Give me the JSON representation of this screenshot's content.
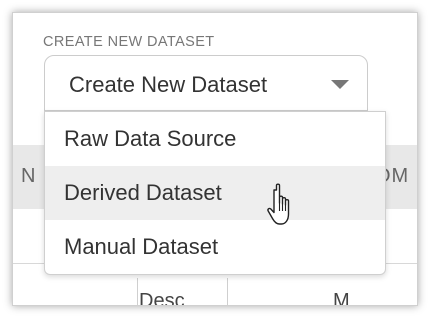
{
  "field": {
    "label": "CREATE NEW DATASET",
    "selected_value": "Create New Dataset"
  },
  "dropdown": {
    "items": [
      {
        "label": "Raw Data Source"
      },
      {
        "label": "Derived Dataset",
        "hovered": true
      },
      {
        "label": "Manual Dataset"
      }
    ]
  },
  "background_table": {
    "header_left_fragment": "N",
    "header_right_fragment": "OM",
    "row_cell_1_fragment": "Desc",
    "row_cell_2_fragment": "M"
  },
  "cursor": {
    "type": "hand-pointer-icon"
  },
  "colors": {
    "label_gray": "#777777",
    "text": "#333333",
    "hover_bg": "#eeeeee",
    "border": "#cccccc"
  }
}
